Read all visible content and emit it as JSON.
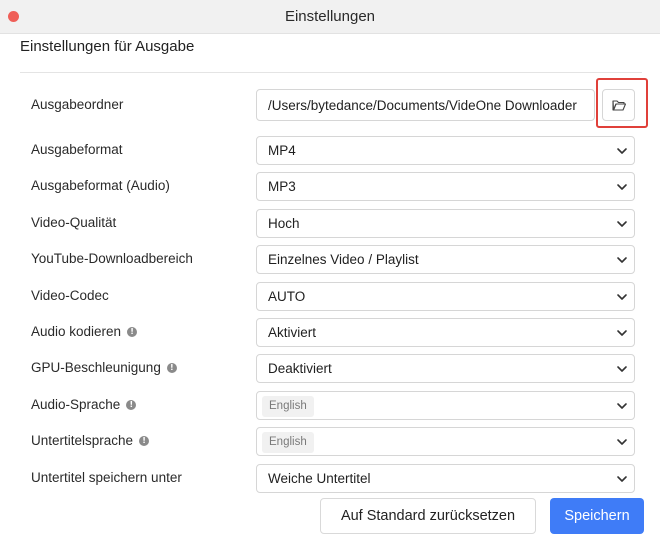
{
  "window": {
    "title": "Einstellungen",
    "close_color": "#ef5f58"
  },
  "section": {
    "title": "Einstellungen für Ausgabe"
  },
  "output_folder": {
    "label": "Ausgabeordner",
    "value": "/Users/bytedance/Documents/VideOne Downloader",
    "browse_icon": "folder-open-icon"
  },
  "settings": [
    {
      "key": "output_format",
      "label": "Ausgabeformat",
      "value": "MP4",
      "placeholder": false,
      "info": false
    },
    {
      "key": "output_format_audio",
      "label": "Ausgabeformat (Audio)",
      "value": "MP3",
      "placeholder": false,
      "info": false
    },
    {
      "key": "video_quality",
      "label": "Video-Qualität",
      "value": "Hoch",
      "placeholder": false,
      "info": false
    },
    {
      "key": "youtube_range",
      "label": "YouTube-Downloadbereich",
      "value": "Einzelnes Video / Playlist",
      "placeholder": false,
      "info": false
    },
    {
      "key": "video_codec",
      "label": "Video-Codec",
      "value": "AUTO",
      "placeholder": false,
      "info": false
    },
    {
      "key": "audio_encode",
      "label": "Audio kodieren",
      "value": "Aktiviert",
      "placeholder": false,
      "info": true
    },
    {
      "key": "gpu_accel",
      "label": "GPU-Beschleunigung",
      "value": "Deaktiviert",
      "placeholder": false,
      "info": true
    },
    {
      "key": "audio_language",
      "label": "Audio-Sprache",
      "value": "English",
      "placeholder": true,
      "info": true
    },
    {
      "key": "subtitle_language",
      "label": "Untertitelsprache",
      "value": "English",
      "placeholder": true,
      "info": true
    },
    {
      "key": "subtitle_save_as",
      "label": "Untertitel speichern unter",
      "value": "Weiche Untertitel",
      "placeholder": false,
      "info": false
    }
  ],
  "info_glyph": "!",
  "footer": {
    "reset_label": "Auf Standard zurücksetzen",
    "save_label": "Speichern",
    "save_color": "#3f7cf7"
  },
  "highlight_color": "#e0403a"
}
